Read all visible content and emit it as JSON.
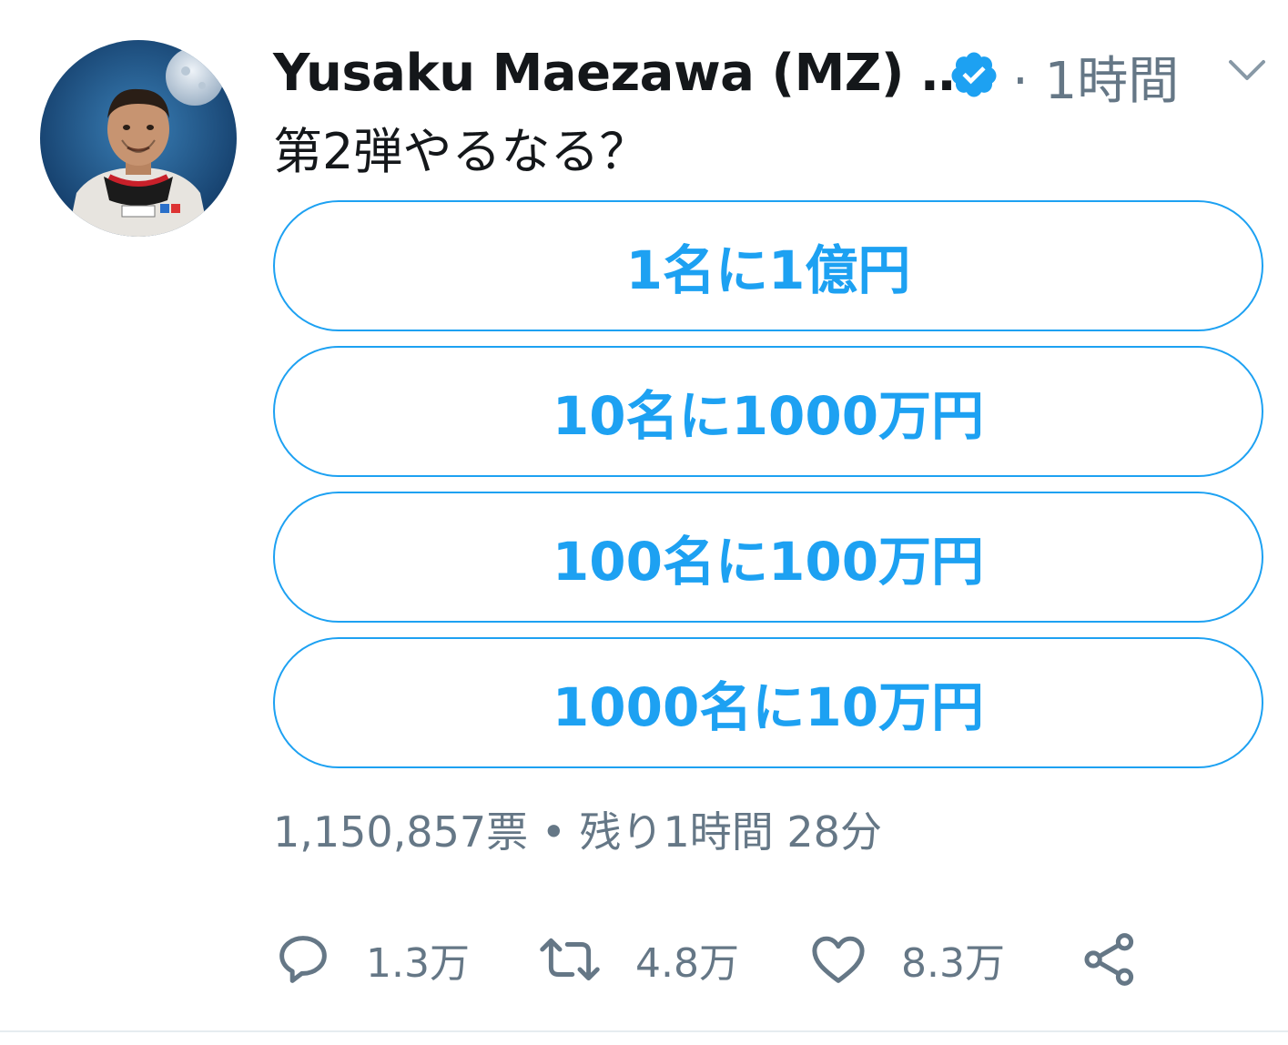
{
  "user": {
    "display_name": "Yusaku Maezawa (MZ) …",
    "verified": true,
    "time_separator": "·",
    "time": "1時間",
    "avatar_icon": "astronaut-portrait"
  },
  "tweet": {
    "text": "第2弾やるなる？"
  },
  "poll": {
    "options": [
      {
        "label": "1名に1億円"
      },
      {
        "label": "10名に1000万円"
      },
      {
        "label": "100名に100万円"
      },
      {
        "label": "1000名に10万円"
      }
    ],
    "votes": "1,150,857票",
    "separator": "•",
    "remaining": "残り1時間 28分"
  },
  "actions": {
    "reply_count": "1.3万",
    "retweet_count": "4.8万",
    "like_count": "8.3万"
  },
  "colors": {
    "accent": "#1da1f2",
    "text_primary": "#14171a",
    "text_secondary": "#657786",
    "divider": "#e6ecf0"
  }
}
